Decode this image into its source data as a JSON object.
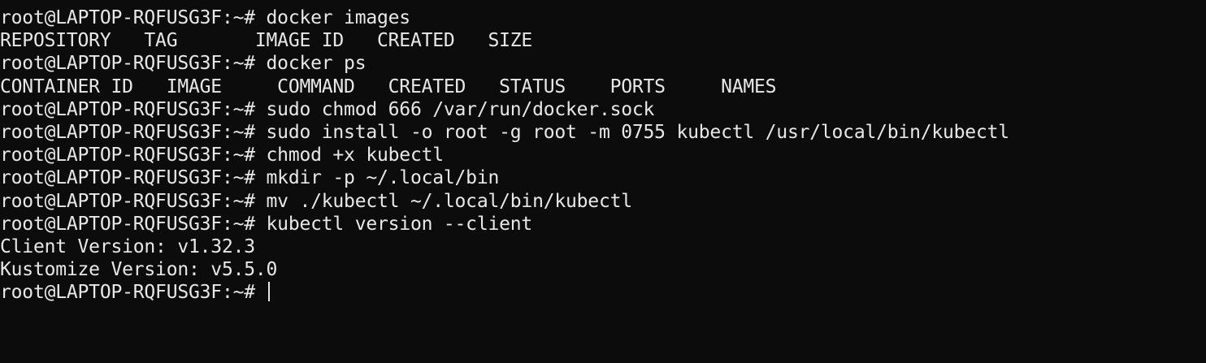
{
  "terminal": {
    "lines": [
      "root@LAPTOP-RQFUSG3F:~# docker images",
      "REPOSITORY   TAG       IMAGE ID   CREATED   SIZE",
      "root@LAPTOP-RQFUSG3F:~# docker ps",
      "CONTAINER ID   IMAGE     COMMAND   CREATED   STATUS    PORTS     NAMES",
      "root@LAPTOP-RQFUSG3F:~# sudo chmod 666 /var/run/docker.sock",
      "root@LAPTOP-RQFUSG3F:~# sudo install -o root -g root -m 0755 kubectl /usr/local/bin/kubectl",
      "root@LAPTOP-RQFUSG3F:~# chmod +x kubectl",
      "root@LAPTOP-RQFUSG3F:~# mkdir -p ~/.local/bin",
      "root@LAPTOP-RQFUSG3F:~# mv ./kubectl ~/.local/bin/kubectl",
      "root@LAPTOP-RQFUSG3F:~# kubectl version --client",
      "Client Version: v1.32.3",
      "Kustomize Version: v5.5.0"
    ],
    "prompt": "root@LAPTOP-RQFUSG3F:~# "
  }
}
